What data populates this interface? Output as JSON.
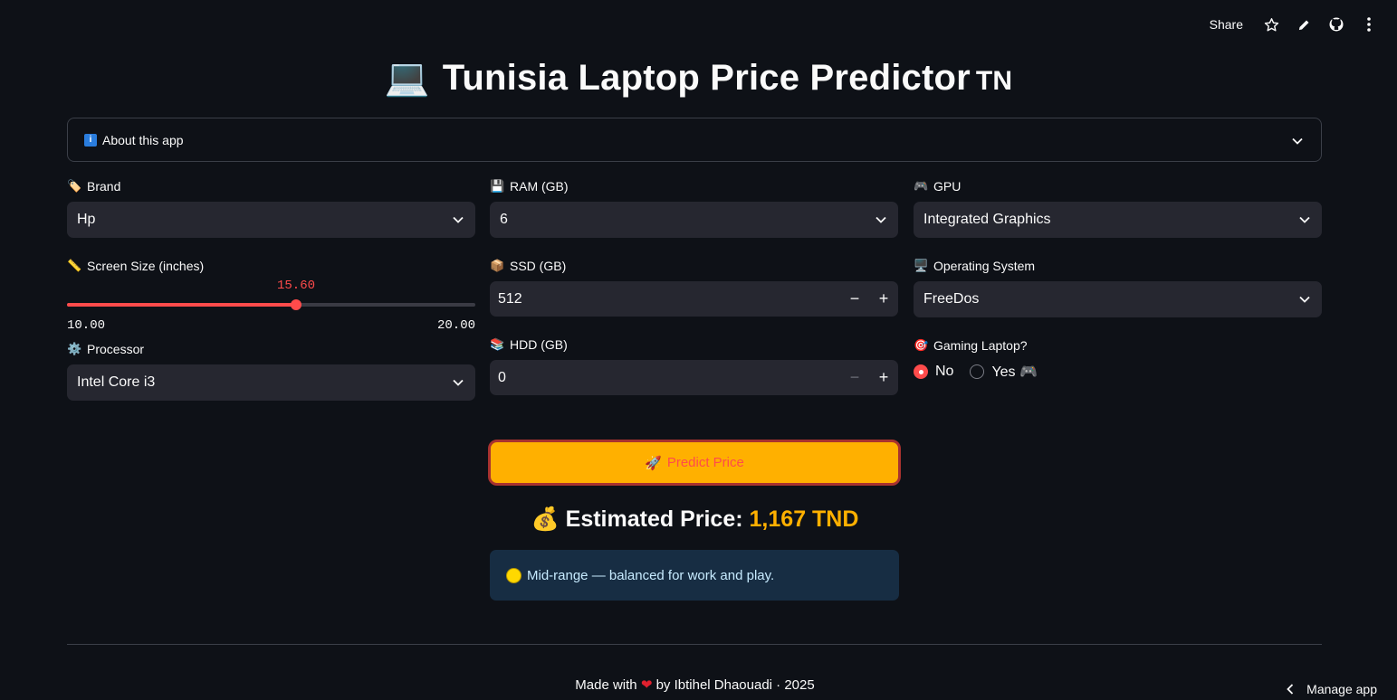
{
  "toolbar": {
    "share_label": "Share",
    "icons": [
      "star-icon",
      "pencil-icon",
      "github-icon",
      "more-vertical-icon"
    ]
  },
  "title": {
    "emoji": "💻",
    "text": "Tunisia Laptop Price Predictor",
    "flag": "TN"
  },
  "about": {
    "icon": "i",
    "label": "About this app"
  },
  "brand": {
    "emoji": "🏷️",
    "label": "Brand",
    "value": "Hp"
  },
  "screen": {
    "emoji": "📏",
    "label": "Screen Size (inches)",
    "value": "15.60",
    "min": "10.00",
    "max": "20.00",
    "fraction": 0.56
  },
  "processor": {
    "emoji": "⚙️",
    "label": "Processor",
    "value": "Intel Core i3"
  },
  "ram": {
    "emoji": "💾",
    "label": "RAM (GB)",
    "value": "6"
  },
  "ssd": {
    "emoji": "📦",
    "label": "SSD (GB)",
    "value": "512",
    "minus": "−",
    "plus": "+"
  },
  "hdd": {
    "emoji": "📚",
    "label": "HDD (GB)",
    "value": "0",
    "minus": "−",
    "plus": "+"
  },
  "gpu": {
    "emoji": "🎮",
    "label": "GPU",
    "value": "Integrated Graphics"
  },
  "os": {
    "emoji": "🖥️",
    "label": "Operating System",
    "value": "FreeDos"
  },
  "gaming": {
    "emoji": "🎯",
    "label": "Gaming Laptop?",
    "option_no": "No",
    "option_yes": "Yes 🎮",
    "selected": "No"
  },
  "predict": {
    "emoji": "🚀",
    "label": "Predict Price"
  },
  "estimate": {
    "emoji": "💰",
    "label": "Estimated Price:",
    "amount": "1,167 TND"
  },
  "callout": {
    "text": "Mid-range — balanced for work and play."
  },
  "footer": {
    "made_with": "Made with",
    "heart": "❤",
    "by": "by Ibtihel Dhaouadi · 2025"
  },
  "manage": {
    "label": "Manage app"
  },
  "colors": {
    "background": "#0e1117",
    "accent": "#ff4b4b",
    "button": "#ffb000",
    "price": "#ffb000",
    "callout_bg": "#172d43"
  }
}
